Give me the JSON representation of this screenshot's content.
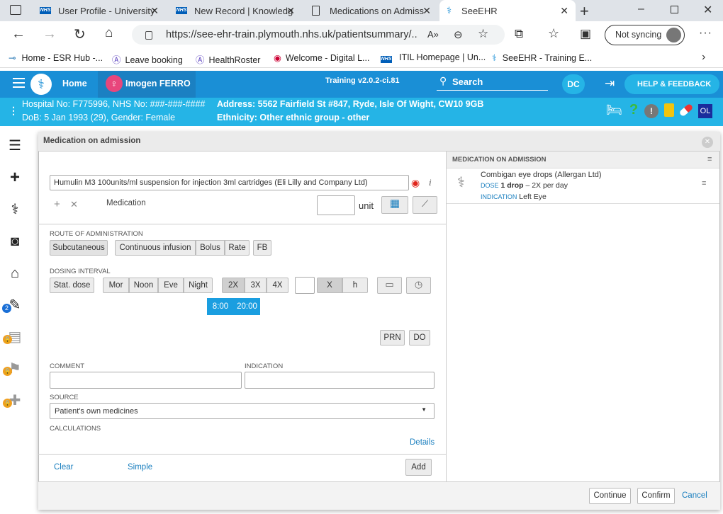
{
  "browser": {
    "tabs": [
      {
        "title": "User Profile - University"
      },
      {
        "title": "New Record | Knowledg"
      },
      {
        "title": "Medications on Admiss"
      },
      {
        "title": "SeeEHR"
      }
    ],
    "url": "https://see-ehr-train.plymouth.nhs.uk/patientsummary/...",
    "sync_label": "Not syncing",
    "bookmarks": [
      {
        "label": "Home - ESR Hub -..."
      },
      {
        "label": "Leave booking"
      },
      {
        "label": "HealthRoster"
      },
      {
        "label": "Welcome - Digital L..."
      },
      {
        "label": "ITIL Homepage | Un..."
      },
      {
        "label": "SeeEHR - Training E..."
      }
    ]
  },
  "app": {
    "home_label": "Home",
    "patient_name": "Imogen FERRO",
    "version": "Training v2.0.2-ci.81",
    "search_label": "Search",
    "user_initials": "DC",
    "help_label": "HELP & FEEDBACK",
    "ol_label": "OL"
  },
  "patient": {
    "ids": "Hospital No: F775996, NHS No: ###-###-####",
    "dob_gender": "DoB: 5 Jan 1993 (29), Gender: Female",
    "address": "Address: 5562 Fairfield St #847, Ryde, Isle Of Wight, CW10 9GB",
    "ethnicity": "Ethnicity: Other ethnic group - other"
  },
  "rail": {
    "badge": "2"
  },
  "modal": {
    "title": "Medication on admission",
    "medication_value": "Humulin M3 100units/ml suspension for injection 3ml cartridges (Eli Lilly and Company Ltd)",
    "medication_label": "Medication",
    "unit_label": "unit",
    "route_label": "ROUTE OF ADMINISTRATION",
    "routes": [
      "Subcutaneous",
      "Continuous infusion",
      "Bolus",
      "Rate",
      "FB"
    ],
    "dosing_label": "DOSING INTERVAL",
    "stat_dose": "Stat. dose",
    "times": [
      "Mor",
      "Noon",
      "Eve",
      "Night"
    ],
    "freq": [
      "2X",
      "3X",
      "4X"
    ],
    "x_label": "X",
    "h_label": "h",
    "schedule": [
      "8:00",
      "20:00"
    ],
    "prn": "PRN",
    "do": "DO",
    "comment_label": "COMMENT",
    "indication_label": "INDICATION",
    "source_label": "SOURCE",
    "source_value": "Patient's own medicines",
    "calculations_label": "CALCULATIONS",
    "details_link": "Details",
    "clear_link": "Clear",
    "simple_link": "Simple",
    "add_button": "Add",
    "continue_button": "Continue",
    "confirm_button": "Confirm",
    "cancel_link": "Cancel"
  },
  "right_panel": {
    "heading": "MEDICATION ON ADMISSION",
    "items": [
      {
        "name": "Combigan eye drops (Allergan Ltd)",
        "dose_label": "DOSE",
        "dose_value": "1 drop",
        "dose_freq": " – 2X per day",
        "indication_label": "INDICATION",
        "indication_value": "Left Eye"
      }
    ]
  },
  "colors": {
    "app_header": "#1a8fd6",
    "patient_bar": "#25b4e6",
    "active_time": "#1a9ee0",
    "link": "#1a7fbf"
  }
}
